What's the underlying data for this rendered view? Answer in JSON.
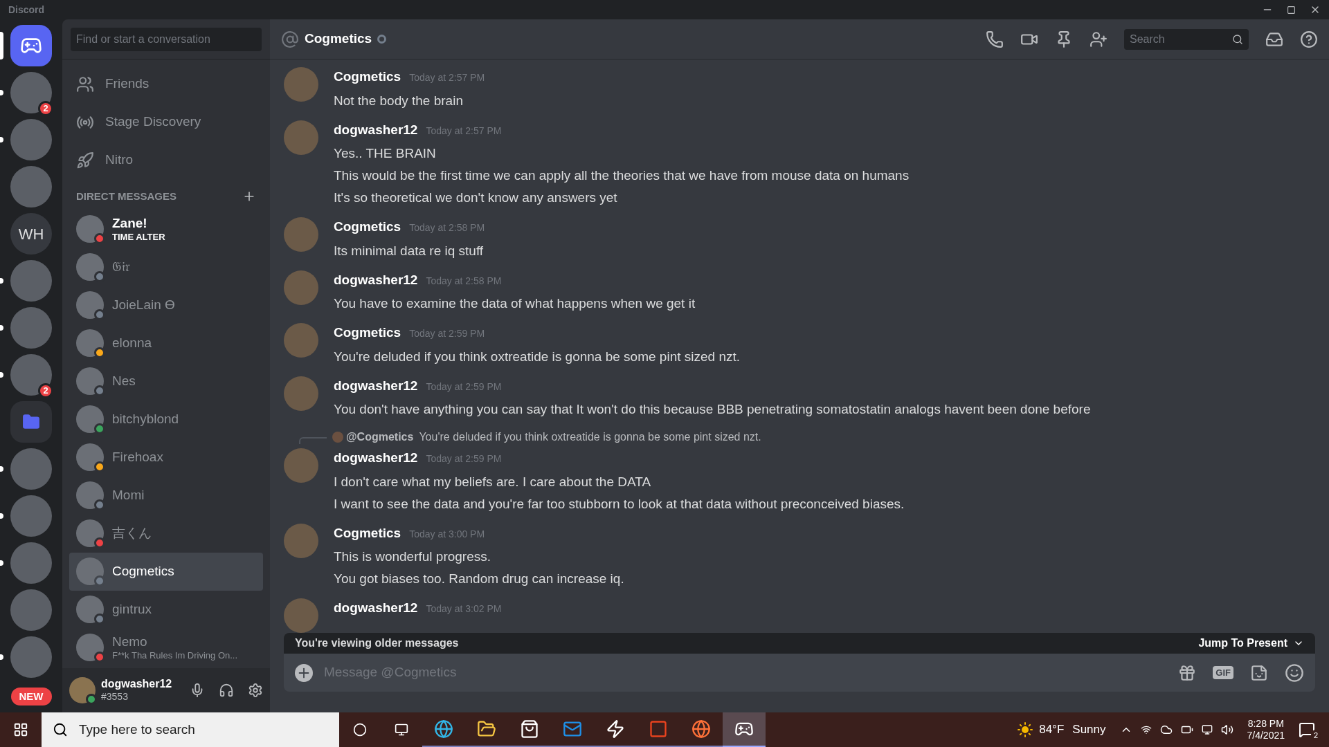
{
  "window": {
    "title": "Discord"
  },
  "servers": [
    {
      "kind": "home",
      "selected": true,
      "unread": false
    },
    {
      "kind": "avatar",
      "badge": "2",
      "unread": true,
      "selected": false
    },
    {
      "kind": "avatar",
      "unread": true,
      "selected": false
    },
    {
      "kind": "avatar",
      "unread": false,
      "selected": false
    },
    {
      "kind": "text",
      "label": "WH",
      "unread": false,
      "selected": false
    },
    {
      "kind": "avatar",
      "unread": true,
      "selected": false
    },
    {
      "kind": "avatar",
      "unread": true,
      "selected": false
    },
    {
      "kind": "avatar",
      "badge": "2",
      "unread": true,
      "selected": false
    },
    {
      "kind": "folder",
      "unread": false,
      "selected": false
    },
    {
      "kind": "avatar",
      "unread": true,
      "selected": false
    },
    {
      "kind": "avatar",
      "unread": true,
      "selected": false
    },
    {
      "kind": "avatar",
      "unread": true,
      "selected": false
    },
    {
      "kind": "avatar",
      "unread": false,
      "selected": false
    },
    {
      "kind": "avatar",
      "unread": true,
      "selected": false
    }
  ],
  "new_badge": "NEW",
  "search": {
    "placeholder": "Find or start a conversation"
  },
  "nav": [
    {
      "kind": "friends",
      "label": "Friends"
    },
    {
      "kind": "stage",
      "label": "Stage Discovery"
    },
    {
      "kind": "nitro",
      "label": "Nitro"
    }
  ],
  "dm_header": "DIRECT MESSAGES",
  "dms": [
    {
      "name": "Zane!",
      "subtitle": "TIME ALTER",
      "color": "#ed4245",
      "selected": false,
      "bold": true
    },
    {
      "name": "𝔊𝔦𝔯",
      "color": "#747f8d",
      "selected": false,
      "bold": false
    },
    {
      "name": "JoieLain ϴ",
      "color": "#747f8d",
      "selected": false,
      "bold": false
    },
    {
      "name": "elonna",
      "color": "#faa81a",
      "selected": false,
      "bold": false
    },
    {
      "name": "Nes",
      "color": "#747f8d",
      "selected": false,
      "bold": false
    },
    {
      "name": "bitchyblond",
      "color": "#3ba55d",
      "selected": false,
      "bold": false
    },
    {
      "name": "Firehoax",
      "color": "#faa81a",
      "selected": false,
      "bold": false
    },
    {
      "name": "Momi",
      "color": "#747f8d",
      "selected": false,
      "bold": false
    },
    {
      "name": "吉くん",
      "color": "#ed4245",
      "selected": false,
      "bold": false
    },
    {
      "name": "Cogmetics",
      "color": "#747f8d",
      "selected": true,
      "bold": false
    },
    {
      "name": "gintrux",
      "color": "#747f8d",
      "selected": false,
      "bold": false
    },
    {
      "name": "Nemo",
      "subtitle": "F**k Tha Rules Im Driving On...",
      "color": "#ed4245",
      "selected": false,
      "bold": false
    }
  ],
  "user": {
    "name": "dogwasher12",
    "tag": "#3553",
    "color": "#3ba55d"
  },
  "channel": {
    "name": "Cogmetics",
    "color": "#747f8d",
    "search_placeholder": "Search"
  },
  "messages": [
    {
      "author": "Cogmetics",
      "time": "Today at 2:57 PM",
      "lines": [
        "Not the body the brain"
      ]
    },
    {
      "author": "dogwasher12",
      "time": "Today at 2:57 PM",
      "lines": [
        "Yes.. THE BRAIN",
        "This would be the first time we can apply all the theories that we have from mouse data on humans",
        "It's so theoretical we don't know any answers yet"
      ]
    },
    {
      "author": "Cogmetics",
      "time": "Today at 2:58 PM",
      "lines": [
        "Its minimal data re iq stuff"
      ]
    },
    {
      "author": "dogwasher12",
      "time": "Today at 2:58 PM",
      "lines": [
        "You have to examine the data of what happens when we get it"
      ]
    },
    {
      "author": "Cogmetics",
      "time": "Today at 2:59 PM",
      "lines": [
        "You're deluded if you think oxtreatide is gonna be some pint sized nzt."
      ]
    },
    {
      "author": "dogwasher12",
      "time": "Today at 2:59 PM",
      "lines": [
        "You don't have anything you can say that It won't do this because BBB penetrating somatostatin analogs havent been done before"
      ]
    },
    {
      "author": "dogwasher12",
      "time": "Today at 2:59 PM",
      "reply": {
        "author": "@Cogmetics",
        "text": "You're deluded if you think oxtreatide is gonna be some pint sized nzt."
      },
      "lines": [
        "I don't care what my beliefs are. I care about the DATA",
        "I want to see the data and you're far too stubborn to look at that data without preconceived biases."
      ]
    },
    {
      "author": "Cogmetics",
      "time": "Today at 3:00 PM",
      "lines": [
        "This is wonderful progress.",
        "You got biases too. Random drug can increase iq."
      ]
    },
    {
      "author": "dogwasher12",
      "time": "Today at 3:02 PM"
    }
  ],
  "older_bar": {
    "text": "You're viewing older messages",
    "action": "Jump To Present"
  },
  "composer": {
    "placeholder": "Message @Cogmetics",
    "gif": "GIF"
  },
  "taskbar": {
    "search_placeholder": "Type here to search",
    "apps": [
      {
        "kind": "edge",
        "selected": false
      },
      {
        "kind": "files",
        "selected": false
      },
      {
        "kind": "store",
        "selected": false
      },
      {
        "kind": "mail",
        "selected": false
      },
      {
        "kind": "bolt",
        "selected": false
      },
      {
        "kind": "office",
        "selected": false
      },
      {
        "kind": "firefox",
        "selected": false
      },
      {
        "kind": "discord",
        "selected": true
      }
    ],
    "temp": "84°F",
    "weather": "Sunny",
    "time": "8:28 PM",
    "date": "7/4/2021",
    "notifications": "2"
  }
}
